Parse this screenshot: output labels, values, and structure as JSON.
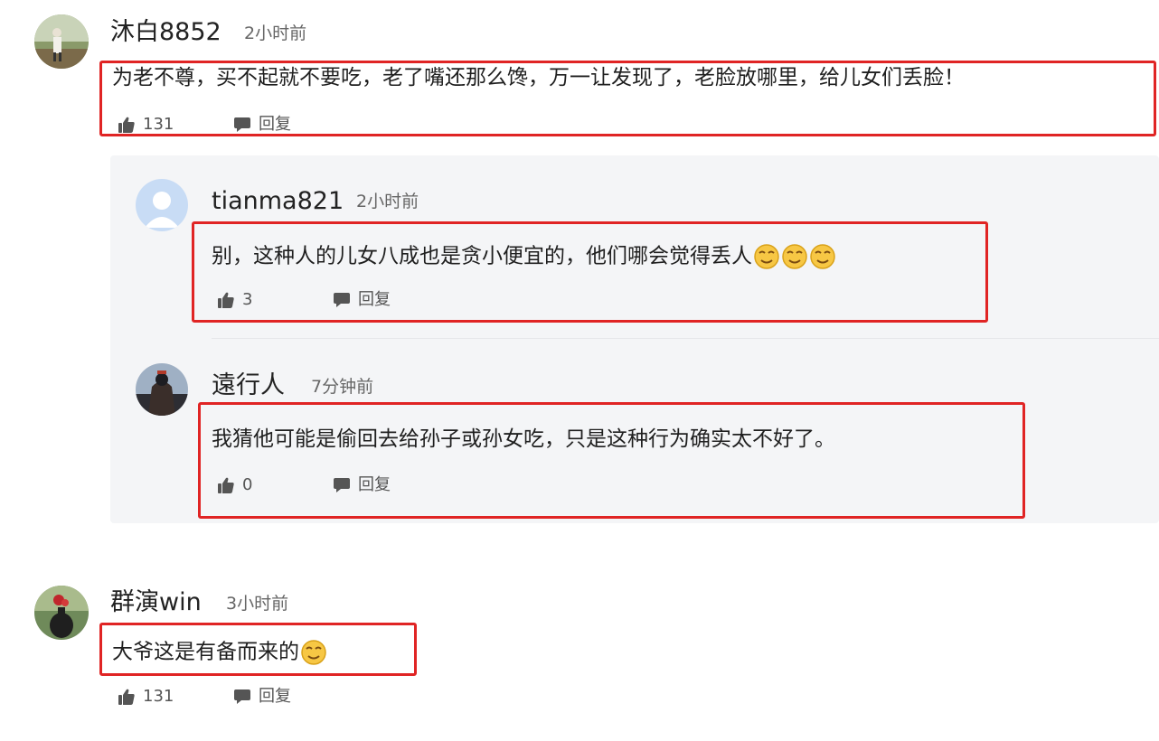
{
  "comments": [
    {
      "username": "沐白8852",
      "time": "2小时前",
      "text": "为老不尊，买不起就不要吃，老了嘴还那么馋，万一让发现了，老脸放哪里，给儿女们丢脸！",
      "likes": "131",
      "reply_label": "回复"
    },
    {
      "username": "群演win",
      "time": "3小时前",
      "text": "大爷这是有备而来的",
      "likes": "131",
      "reply_label": "回复"
    }
  ],
  "replies": [
    {
      "username": "tianma821",
      "time": "2小时前",
      "text": "别，这种人的儿女八成也是贪小便宜的，他们哪会觉得丢人",
      "likes": "3",
      "reply_label": "回复"
    },
    {
      "username": "遠行人",
      "time": "7分钟前",
      "text": "我猜他可能是偷回去给孙子或孙女吃，只是这种行为确实太不好了。",
      "likes": "0",
      "reply_label": "回复"
    }
  ],
  "colors": {
    "highlight": "#e02424",
    "panel": "#f4f5f7",
    "emoji": "#f7c744"
  }
}
